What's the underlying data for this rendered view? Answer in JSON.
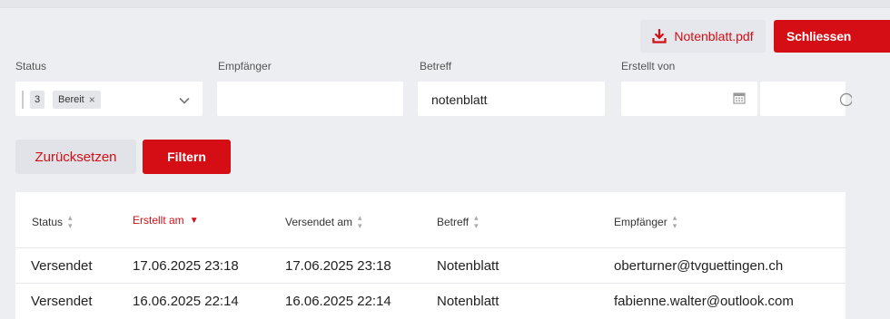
{
  "header": {
    "pdf_label": "Notenblatt.pdf",
    "close_label": "Schliessen"
  },
  "filters": {
    "status": {
      "label": "Status",
      "chip_count": "3",
      "chip_label": "Bereit",
      "chip_remove": "×"
    },
    "recipient": {
      "label": "Empfänger",
      "value": ""
    },
    "subject": {
      "label": "Betreff",
      "value": "notenblatt"
    },
    "created_by": {
      "label": "Erstellt von",
      "value": ""
    }
  },
  "actions": {
    "reset_label": "Zurücksetzen",
    "filter_label": "Filtern"
  },
  "table": {
    "columns": [
      {
        "label": "Status",
        "sort": "both"
      },
      {
        "label": "Erstellt am",
        "sort": "desc",
        "active": true
      },
      {
        "label": "Versendet am",
        "sort": "both"
      },
      {
        "label": "Betreff",
        "sort": "both"
      },
      {
        "label": "Empfänger",
        "sort": "both"
      }
    ],
    "rows": [
      {
        "status": "Versendet",
        "created": "17.06.2025 23:18",
        "sent": "17.06.2025 23:18",
        "subject": "Notenblatt",
        "recipient": "oberturner@tvguettingen.ch"
      },
      {
        "status": "Versendet",
        "created": "16.06.2025 22:14",
        "sent": "16.06.2025 22:14",
        "subject": "Notenblatt",
        "recipient": "fabienne.walter@outlook.com"
      }
    ]
  },
  "colors": {
    "accent": "#d40e14",
    "background": "#eceef2",
    "button_secondary": "#e1e3e8"
  }
}
